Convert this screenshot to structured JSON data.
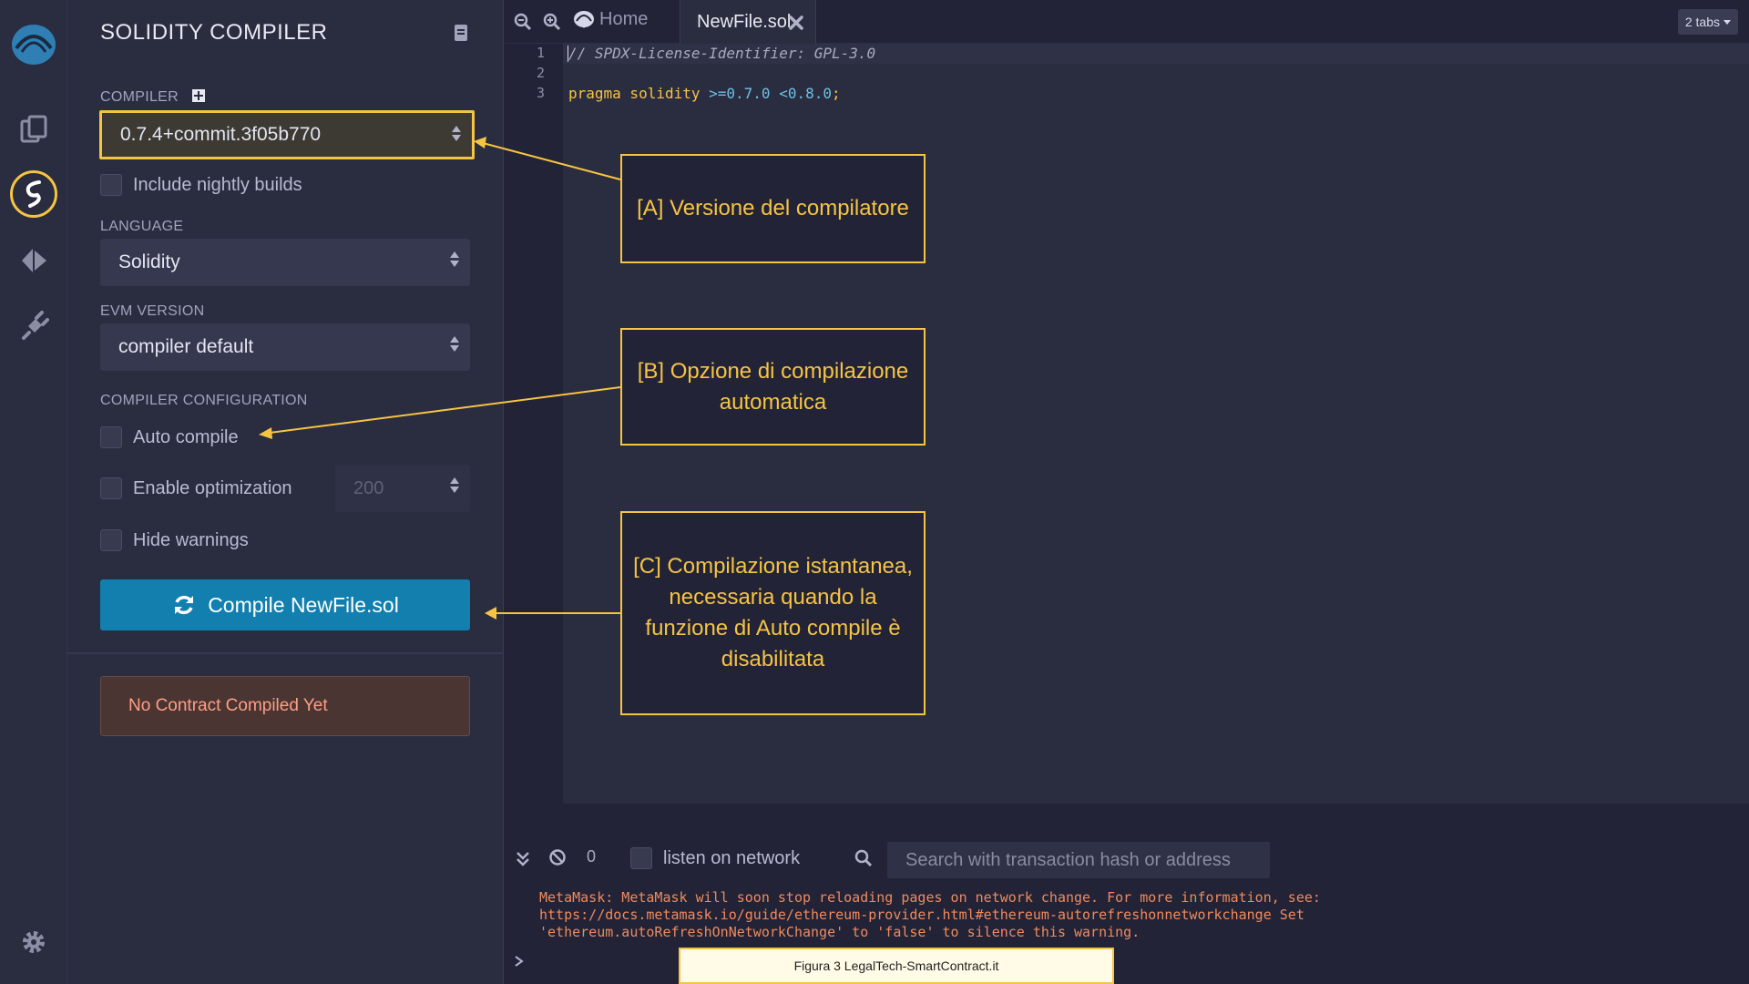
{
  "sidepanel": {
    "title": "SOLIDITY COMPILER",
    "compiler_label": "COMPILER",
    "compiler_version": "0.7.4+commit.3f05b770",
    "nightly_label": "Include nightly builds",
    "language_label": "LANGUAGE",
    "language_value": "Solidity",
    "evm_label": "EVM VERSION",
    "evm_value": "compiler default",
    "config_label": "COMPILER CONFIGURATION",
    "auto_compile": "Auto compile",
    "enable_optimization": "Enable optimization",
    "optimization_runs": "200",
    "hide_warnings": "Hide warnings",
    "compile_button": "Compile NewFile.sol",
    "no_contract": "No Contract Compiled Yet"
  },
  "iconbar": {
    "items": [
      "remix-logo-icon",
      "file-explorer-icon",
      "solidity-compiler-icon",
      "deploy-run-icon",
      "plugin-manager-icon",
      "settings-icon"
    ]
  },
  "tabs": {
    "home": "Home",
    "active": "NewFile.sol",
    "count": "2 tabs"
  },
  "editor": {
    "line_numbers": [
      "1",
      "2",
      "3"
    ],
    "line1": "// SPDX-License-Identifier: GPL-3.0",
    "line3_kw": "pragma solidity",
    "line3_ver": " >=0.7.0 <0.8.0",
    "line3_end": ";"
  },
  "terminal": {
    "count": "0",
    "listen": "listen on network",
    "search_placeholder": "Search with transaction hash or address",
    "message": "MetaMask: MetaMask will soon stop reloading pages on network change. For more information, see:\nhttps://docs.metamask.io/guide/ethereum-provider.html#ethereum-autorefreshonnetworkchange Set\n'ethereum.autoRefreshOnNetworkChange' to 'false' to silence this warning."
  },
  "annotations": {
    "a": "[A] Versione del compilatore",
    "b": "[B] Opzione di compilazione automatica",
    "c": "[C] Compilazione istantanea, necessaria quando la funzione di Auto compile è disabilitata"
  },
  "caption": "Figura 3 LegalTech-SmartContract.it",
  "colors": {
    "accent": "#f6c443",
    "compile_button": "#127faf",
    "panel_bg": "#2a2c3f",
    "editor_bg": "#2a2c3f",
    "error_text": "#ff9e84"
  }
}
